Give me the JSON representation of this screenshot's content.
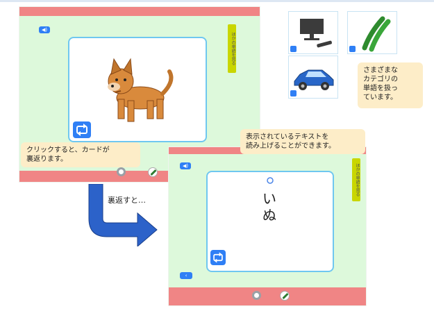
{
  "annotations": {
    "click_note": "クリックすると、カードが\n裏返ります。",
    "categories_note": "さまざまな\nカテゴリの\n単語を扱っ\nています。",
    "readout_note": "表示されているテキストを\n読み上げることができます。",
    "flip_caption": "裏返すと…"
  },
  "front_screen": {
    "side_tab": "ほかの単語を見る",
    "card_image": "dog"
  },
  "back_screen": {
    "side_tab": "ほかの単語を見る",
    "card_word_line1": "い",
    "card_word_line2": "ぬ"
  },
  "category_icons": [
    "tv-icon",
    "cucumber-icon",
    "car-icon"
  ],
  "colors": {
    "app_bg": "#ddf9db",
    "bar": "#f08585",
    "accent_blue": "#2f7ff5",
    "callout": "#fdedc8",
    "side_tab": "#c9d600",
    "card_border": "#6fc7f0",
    "arrow": "#2c62c9"
  }
}
